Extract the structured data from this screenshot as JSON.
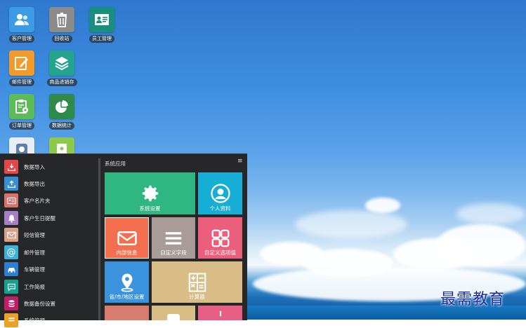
{
  "desktop_icons": [
    {
      "label": "客户管理",
      "icon": "customer-icon",
      "color": "#3b9be4"
    },
    {
      "label": "回收站",
      "icon": "trash-icon",
      "color": "#8a8a8a"
    },
    {
      "label": "员工管理",
      "icon": "employee-card-icon",
      "color": "#19907e"
    },
    {
      "label": "邮件管理",
      "icon": "edit-icon",
      "color": "#f29b2a"
    },
    {
      "label": "商品进销存",
      "icon": "box-icon",
      "color": "#26a38e"
    },
    {
      "label": "订单管理",
      "icon": "clipboard-gear-icon",
      "color": "#5cbd58"
    },
    {
      "label": "数据统计",
      "icon": "pie-chart-icon",
      "color": "#2d8a4b"
    }
  ],
  "start_menu": {
    "items": [
      {
        "label": "数据导入",
        "icon": "import-icon",
        "color": "#e2474a"
      },
      {
        "label": "数据导出",
        "icon": "export-icon",
        "color": "#3a8fd4"
      },
      {
        "label": "客户名片夹",
        "icon": "card-icon",
        "color": "#d9726c"
      },
      {
        "label": "客户生日提醒",
        "icon": "bell-icon",
        "color": "#a67ec2"
      },
      {
        "label": "短信管理",
        "icon": "message-icon",
        "color": "#d8a086"
      },
      {
        "label": "邮件管理",
        "icon": "at-icon",
        "color": "#3bb2d6"
      },
      {
        "label": "车辆管理",
        "icon": "car-icon",
        "color": "#2f7fd0"
      },
      {
        "label": "工作简报",
        "icon": "chat-icon",
        "color": "#16a08f"
      },
      {
        "label": "数据备份设置",
        "icon": "database-icon",
        "color": "#c01e66"
      },
      {
        "label": "系统管理",
        "icon": "list-icon",
        "color": "#e9a227"
      }
    ],
    "section_title": "系统应用",
    "menu_glyph": "≡",
    "tiles": [
      {
        "label": "系统设置",
        "icon": "gear-icon",
        "color": "#2fb683"
      },
      {
        "label": "个人资料",
        "icon": "user-circle-icon",
        "color": "#17aed6"
      },
      {
        "label": "内部信息",
        "icon": "mail-icon",
        "color": "#f46f50"
      },
      {
        "label": "自定义字段",
        "icon": "lines-icon",
        "color": "#a99b98"
      },
      {
        "label": "自定义选项值",
        "icon": "grid-icon",
        "color": "#ec5f7c"
      },
      {
        "label": "省/市/地区设置",
        "icon": "location-icon",
        "color": "#3a93dc"
      },
      {
        "label": "计算器",
        "icon": "calculator-icon",
        "color": "#d9bd86"
      },
      {
        "label": "",
        "icon": "partial-tile",
        "color": "#d97c70"
      },
      {
        "label": "",
        "icon": "partial-tile",
        "color": "#d9bd86"
      },
      {
        "label": "",
        "icon": "partial-tile",
        "color": "#e85f86"
      }
    ]
  },
  "watermark": "最需教育"
}
